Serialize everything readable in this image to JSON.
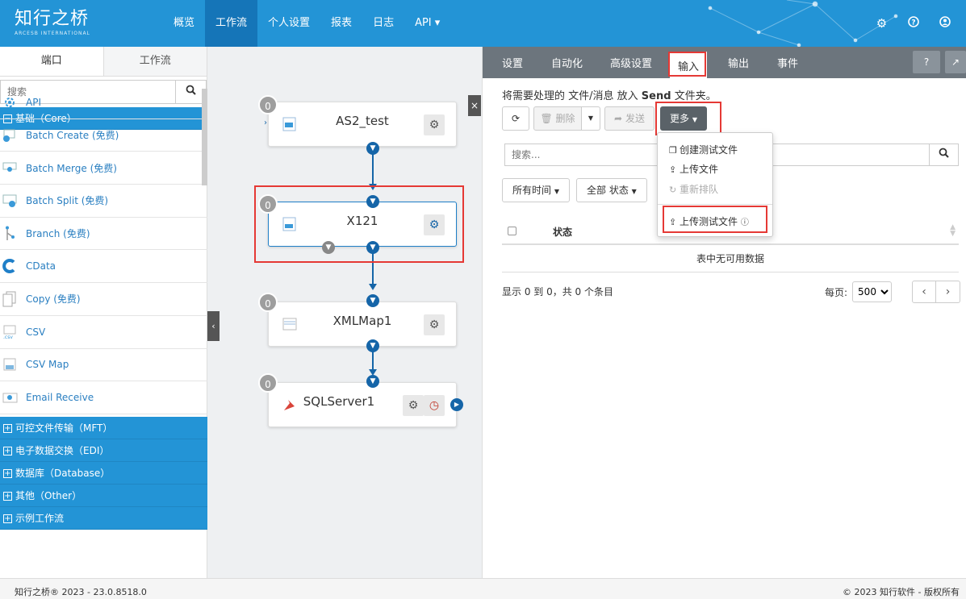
{
  "brand": {
    "name_cn": "知行之桥",
    "name_en": "ARCESB INTERNATIONAL"
  },
  "nav": [
    {
      "label": "概览",
      "active": false
    },
    {
      "label": "工作流",
      "active": true
    },
    {
      "label": "个人设置",
      "active": false
    },
    {
      "label": "报表",
      "active": false
    },
    {
      "label": "日志",
      "active": false
    },
    {
      "label": "API ▾",
      "active": false
    }
  ],
  "top_icons": [
    "gear-icon",
    "help-icon",
    "user-icon"
  ],
  "left": {
    "tabs": [
      "端口",
      "工作流"
    ],
    "search_placeholder": "搜索",
    "core_category": "基础（Core）",
    "connectors": [
      {
        "label": "API",
        "icon": "api-icon"
      },
      {
        "label": "Batch Create (免费)",
        "icon": "batch-create-icon"
      },
      {
        "label": "Batch Merge (免费)",
        "icon": "batch-merge-icon"
      },
      {
        "label": "Batch Split (免费)",
        "icon": "batch-split-icon"
      },
      {
        "label": "Branch (免费)",
        "icon": "branch-icon"
      },
      {
        "label": "CData",
        "icon": "cdata-icon"
      },
      {
        "label": "Copy (免费)",
        "icon": "copy-icon"
      },
      {
        "label": "CSV",
        "icon": "csv-icon"
      },
      {
        "label": "CSV Map",
        "icon": "csv-map-icon"
      },
      {
        "label": "Email Receive",
        "icon": "email-receive-icon"
      }
    ],
    "categories": [
      "可控文件传输（MFT）",
      "电子数据交换（EDI）",
      "数据库（Database）",
      "其他（Other）",
      "示例工作流"
    ]
  },
  "flow": {
    "nodes": [
      {
        "name": "AS2_test",
        "count": "0",
        "icon": "as2-icon"
      },
      {
        "name": "X121",
        "count": "0",
        "icon": "x12-icon"
      },
      {
        "name": "XMLMap1",
        "count": "0",
        "icon": "xmlmap-icon"
      },
      {
        "name": "SQLServer1",
        "count": "0",
        "icon": "sqlserver-icon"
      }
    ]
  },
  "right": {
    "tabs": [
      "设置",
      "自动化",
      "高级设置",
      "输入",
      "输出",
      "事件"
    ],
    "active_tab": "输入",
    "hint_prefix": "将需要处理的 文件/消息 放入",
    "hint_bold": "Send",
    "hint_suffix": "文件夹。",
    "buttons": {
      "refresh": "⟳",
      "delete": "删除",
      "send": "发送",
      "more": "更多"
    },
    "more_menu": {
      "create_test": "创建测试文件",
      "upload": "上传文件",
      "requeue": "重新排队",
      "upload_test": "上传测试文件"
    },
    "search_placeholder": "搜索...",
    "filters": {
      "time": "所有时间",
      "status": "全部 状态"
    },
    "table": {
      "col_status": "状态",
      "empty": "表中无可用数据"
    },
    "info": "显示 0 到 0，共 0 个条目",
    "page_size_label": "每页:",
    "page_size": "500"
  },
  "footer": {
    "left": "知行之桥® 2023 - 23.0.8518.0",
    "right": "© 2023 知行软件 - 版权所有"
  },
  "colors": {
    "primary": "#2394d6",
    "nav_active": "#1575b8",
    "flow_blue": "#1565a8",
    "highlight_red": "#e53935"
  }
}
